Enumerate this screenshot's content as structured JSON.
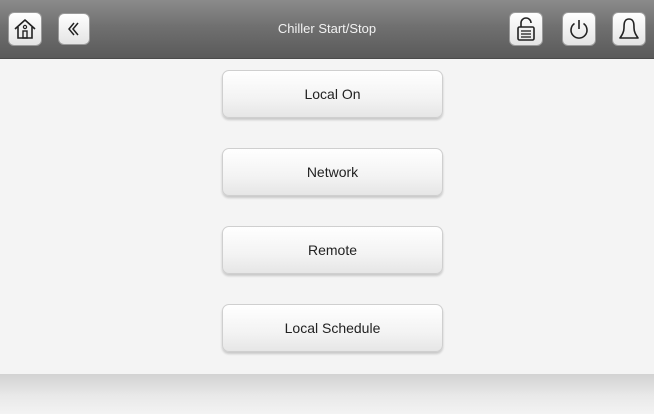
{
  "header": {
    "title": "Chiller Start/Stop",
    "icons": [
      "home-icon",
      "back-icon",
      "lock-icon",
      "power-icon",
      "bell-icon"
    ]
  },
  "menu": {
    "items": [
      {
        "label": "Local On"
      },
      {
        "label": "Network"
      },
      {
        "label": "Remote"
      },
      {
        "label": "Local Schedule"
      }
    ]
  }
}
